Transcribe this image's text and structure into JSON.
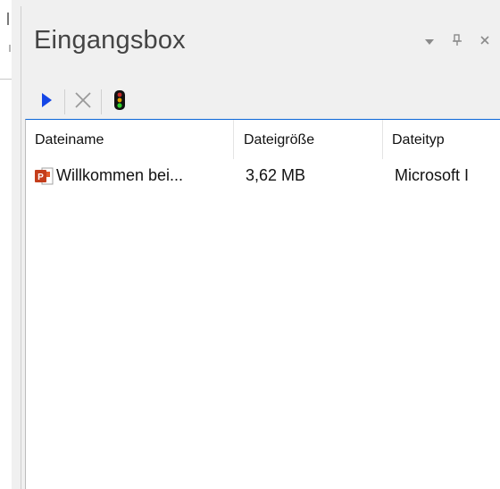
{
  "panel": {
    "title": "Eingangsbox"
  },
  "toolbar": {
    "play_icon": "play-icon",
    "delete_icon": "close-icon",
    "status_icon": "traffic-light-icon"
  },
  "columns": [
    {
      "label": "Dateiname"
    },
    {
      "label": "Dateigröße"
    },
    {
      "label": "Dateityp"
    }
  ],
  "rows": [
    {
      "icon": "powerpoint-file-icon",
      "name": "Willkommen bei...",
      "size": "3,62 MB",
      "type": "Microsoft I"
    }
  ],
  "colors": {
    "play": "#1446e6",
    "selection_border": "#0b66d8",
    "powerpoint": "#c43e1c"
  }
}
